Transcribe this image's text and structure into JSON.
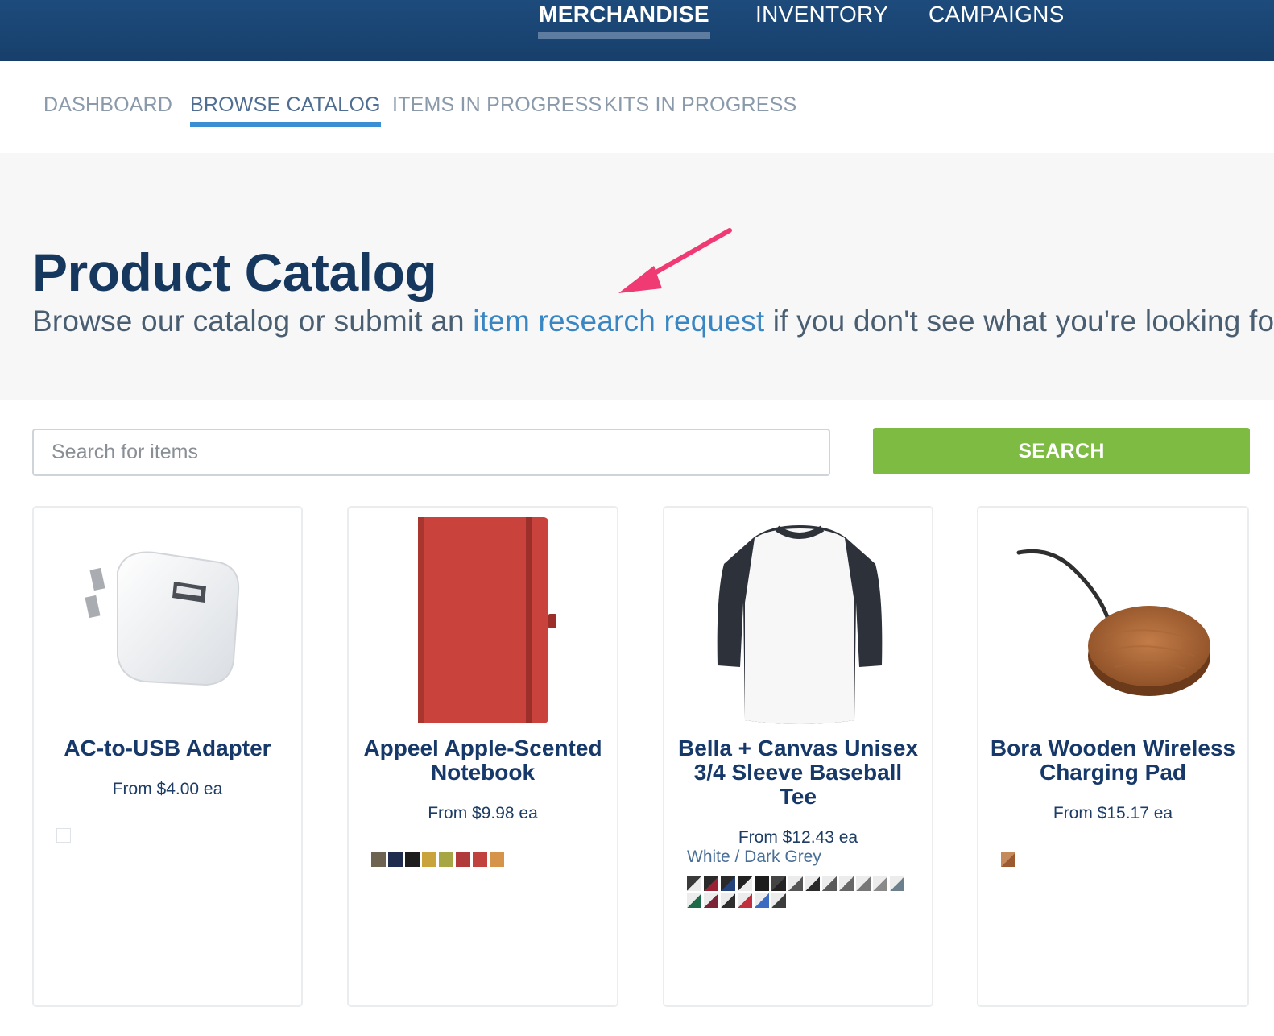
{
  "top_nav": {
    "items": [
      "MERCHANDISE",
      "INVENTORY",
      "CAMPAIGNS"
    ],
    "active": "MERCHANDISE"
  },
  "sub_nav": {
    "items": [
      "DASHBOARD",
      "BROWSE CATALOG",
      "ITEMS IN PROGRESS",
      "KITS IN PROGRESS"
    ],
    "active": "BROWSE CATALOG"
  },
  "hero": {
    "title": "Product Catalog",
    "sub_before": "Browse our catalog or submit an ",
    "sub_link": "item research request",
    "sub_after": " if you don't see what you're looking for"
  },
  "search": {
    "placeholder": "Search for items",
    "button_label": "SEARCH"
  },
  "products": [
    {
      "name": "AC-to-USB Adapter",
      "price": "From $4.00 ea",
      "icon": "usb-adapter-image",
      "swatches": [
        "#ffffff"
      ]
    },
    {
      "name": "Appeel Apple-Scented Notebook",
      "price": "From $9.98 ea",
      "icon": "notebook-image",
      "swatches": [
        "#6e6351",
        "#1f2c4d",
        "#1d1d1d",
        "#c9a43d",
        "#a7a645",
        "#b13a3a",
        "#c0413d",
        "#d6934a"
      ]
    },
    {
      "name": "Bella + Canvas Unisex 3/4 Sleeve Baseball Tee",
      "price": "From $12.43 ea",
      "color_label": "White / Dark Grey",
      "icon": "baseball-tee-image",
      "swatches": [
        "#3a3a3a",
        "#9b2232",
        "#24437a",
        "#222222",
        "#1d1d1d",
        "#444444",
        "#555555",
        "#2a2a2a",
        "#5a5a5a",
        "#666666",
        "#777777",
        "#8a8a8a",
        "#6b7f8c",
        "#1e6b4a",
        "#7a2436",
        "#2e2e2e",
        "#c0303f",
        "#3b6cc1",
        "#3c3c3c"
      ]
    },
    {
      "name": "Bora Wooden Wireless Charging Pad",
      "price": "From $15.17 ea",
      "icon": "charging-pad-image",
      "swatches": [
        "#b3704a"
      ]
    }
  ],
  "colors": {
    "top_bar": "#1d4b7c",
    "accent": "#3a8ed4",
    "search_button": "#7dbb42",
    "annotation_arrow": "#f03a73"
  }
}
